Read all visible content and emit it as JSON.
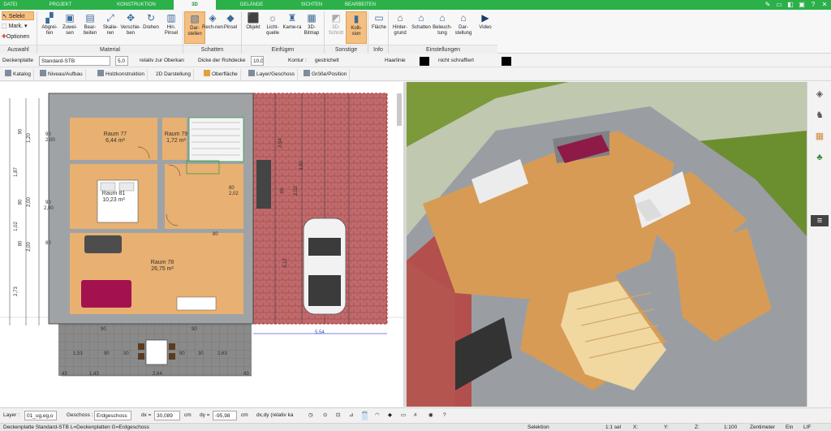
{
  "tabs": [
    "DATEI",
    "PROJEKT",
    "KONSTRUKTION",
    "3D",
    "GELÄNDE",
    "SICHTEN",
    "BEARBEITEN"
  ],
  "window_controls": [
    "pin-icon",
    "ribbon-toggle-icon",
    "maximize-icon",
    "restore-icon",
    "help-icon",
    "close-icon"
  ],
  "ribbon": {
    "selection": {
      "select": "Selekt",
      "mark": "Mark.",
      "options": "Optionen",
      "label": "Auswahl"
    },
    "material": {
      "label": "Material",
      "buttons": [
        "Abgrei-fen",
        "Zuwei-sen",
        "Bear-beiten",
        "Skalie-ren",
        "Verschie-ben",
        "Drehen",
        "Hin. Pinsel"
      ]
    },
    "schatten": {
      "label": "Schatten",
      "buttons": [
        "Dar-stellen",
        "Rech-nen",
        "Pinsel"
      ]
    },
    "einfuegen": {
      "label": "Einfügen",
      "buttons": [
        "Objekt",
        "Licht-quelle",
        "Kame-ra",
        "3D-Bitmap"
      ]
    },
    "sonstige": {
      "label": "Sonstige",
      "buttons": [
        "3D-Schnitt",
        "Kolli-sion"
      ]
    },
    "info": {
      "label": "Info",
      "buttons": [
        "Fläche"
      ]
    },
    "einstellungen": {
      "label": "Einstellungen",
      "buttons": [
        "Hinter-grund",
        "Schatten",
        "Beleuch-tung",
        "Dar-stellung",
        "Video"
      ]
    }
  },
  "props": {
    "layer": "Deckenplatte",
    "style": "Standard-STB",
    "thickness": "5,0",
    "relative": "relativ zur Oberkan",
    "depth_label": "Dicke der Rohdecke",
    "depth_value": "10,0",
    "contour_label": "Kontur :",
    "line_style": "gestrichelt",
    "hair_label": "Haarlinie",
    "hatch": "nicht schraffiert"
  },
  "toolbar2": [
    "Katalog",
    "Niveau/Aufbau",
    "Holzkonstruktion",
    "2D Darstellung",
    "Oberfläche",
    "Layer/Geschoss",
    "Größe/Position"
  ],
  "plan": {
    "rooms": [
      {
        "name": "Raum 77",
        "area": "6,44 m²"
      },
      {
        "name": "Raum 79",
        "area": "1,72 m²"
      },
      {
        "name": "Raum 81",
        "area": "10,23 m²"
      },
      {
        "name": "Raum 78",
        "area": "26,75 m²"
      }
    ],
    "dims_left": [
      "90",
      "1,20",
      "1,87",
      "80",
      "2,00",
      "1,02",
      "80",
      "2,00",
      "2,73"
    ],
    "dims_misc": [
      "90",
      "2,00",
      "90",
      "2,00",
      "80",
      "80",
      "2,02",
      "2,94",
      "3,90",
      "90",
      "2,02",
      "5,12",
      "5,54",
      "1,53",
      "90",
      "30",
      "90",
      "30",
      "2,63",
      "43",
      "2,64",
      "1,43",
      "43",
      "90",
      "90",
      "80"
    ]
  },
  "bottom": {
    "layer_label": "Layer :",
    "layer_value": "01_ug,eg,o",
    "floor_label": "Geschoss :",
    "floor_value": "Erdgeschoss",
    "dx_label": "dx =",
    "dx_value": "30,089",
    "dx_unit": "cm",
    "dy_label": "dy =",
    "dy_value": "-95,98",
    "dy_unit": "cm",
    "dxdy": "dx,dy (relativ ka"
  },
  "status": {
    "left": "Deckenplatte Standard-STB L=Deckenplatten G=Erdgeschoss",
    "mode": "Selektion",
    "count": "1:1 sel",
    "x": "X:",
    "y": "Y:",
    "z": "Z:",
    "scale": "1:100",
    "unit": "Zentimeter",
    "flags": "Ein",
    "last": "LIF"
  },
  "colors": {
    "accent": "#2bb04a",
    "ribbon_active": "#f4bf80",
    "brick": "#b8585a",
    "floor": "#e9b774",
    "wall": "#8f9396",
    "grass": "#6b8f2f"
  }
}
